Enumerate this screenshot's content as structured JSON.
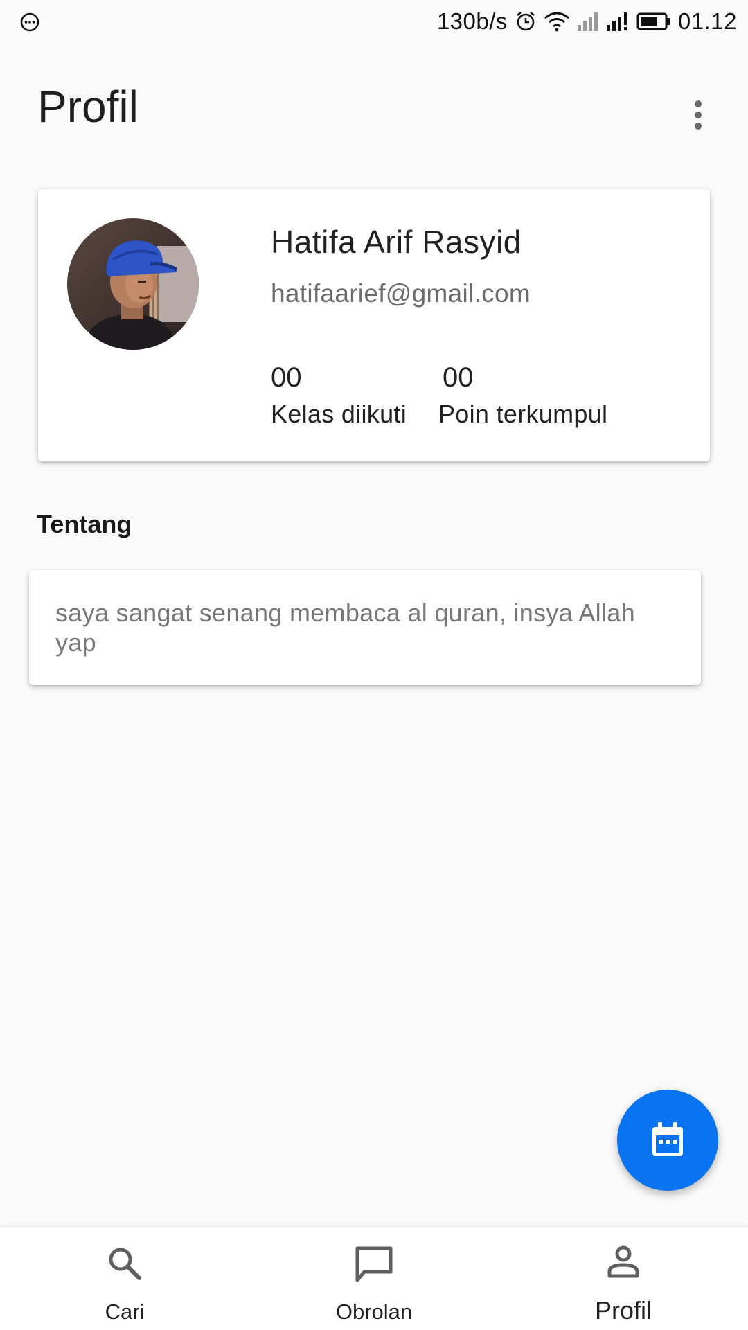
{
  "status_bar": {
    "network_speed": "130b/s",
    "time": "01.12",
    "icons": [
      "chat-bubble-dots-icon",
      "alarm-icon",
      "wifi-icon",
      "signal-icon",
      "signal-icon",
      "battery-icon"
    ]
  },
  "app_bar": {
    "title": "Profil",
    "menu_icon": "more-vert-icon"
  },
  "profile": {
    "name": "Hatifa Arif Rasyid",
    "email": "hatifaarief@gmail.com",
    "stats": [
      {
        "value": "00",
        "label": "Kelas diikuti"
      },
      {
        "value": "00",
        "label": "Poin terkumpul"
      }
    ]
  },
  "about": {
    "title": "Tentang",
    "text": "saya sangat senang membaca al quran, insya Allah yap"
  },
  "fab": {
    "icon": "calendar-icon",
    "color": "#0a73f0"
  },
  "bottom_nav": {
    "active": "Profil",
    "items": [
      {
        "label": "Cari",
        "icon": "search-icon"
      },
      {
        "label": "Obrolan",
        "icon": "chat-icon"
      },
      {
        "label": "Profil",
        "icon": "person-icon"
      }
    ]
  }
}
